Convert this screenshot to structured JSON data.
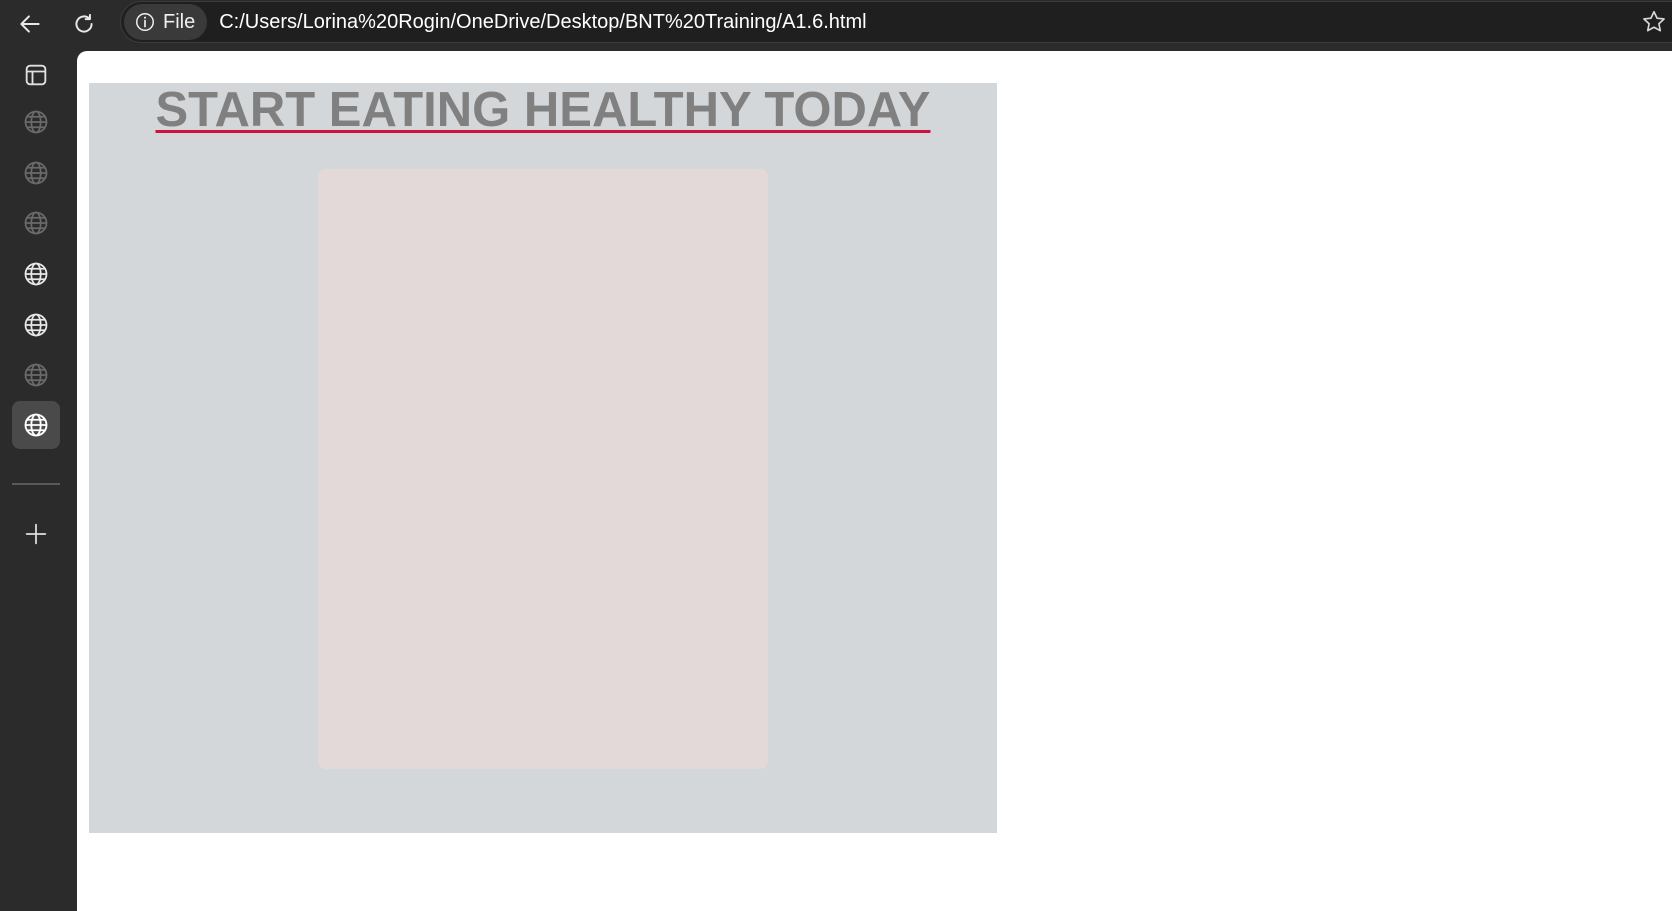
{
  "browser": {
    "site_chip_label": "File",
    "url": "C:/Users/Lorina%20Rogin/OneDrive/Desktop/BNT%20Training/A1.6.html",
    "icons": {
      "back": "back-arrow-icon",
      "reload": "reload-icon",
      "site_info": "info-icon",
      "favorite": "star-icon"
    }
  },
  "sidebar": {
    "items": [
      {
        "icon": "tab-actions-icon",
        "state": "normal"
      },
      {
        "icon": "globe-icon",
        "state": "dimmed"
      },
      {
        "icon": "globe-icon",
        "state": "dimmed"
      },
      {
        "icon": "globe-icon",
        "state": "dimmed"
      },
      {
        "icon": "globe-icon",
        "state": "normal"
      },
      {
        "icon": "globe-icon",
        "state": "normal"
      },
      {
        "icon": "globe-icon",
        "state": "dimmed"
      },
      {
        "icon": "globe-icon",
        "state": "active"
      }
    ],
    "new_tab_icon": "plus-icon"
  },
  "page": {
    "title": "START EATING HEALTHY TODAY",
    "colors": {
      "background": "#d3d7d9",
      "title_text": "#808080",
      "title_underline": "#d0103f",
      "card": "#e3d9d9"
    }
  }
}
